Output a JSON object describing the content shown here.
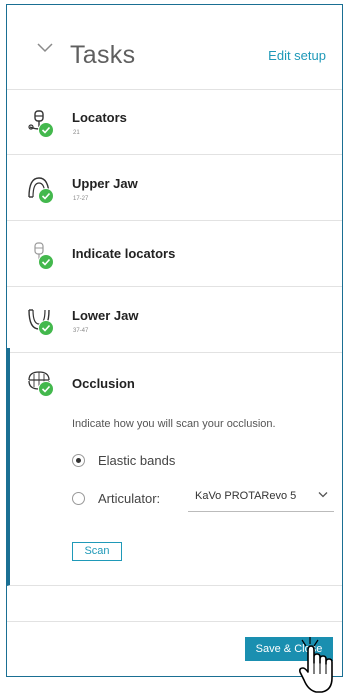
{
  "header": {
    "title": "Tasks",
    "edit_label": "Edit setup"
  },
  "tasks": [
    {
      "name": "Locators",
      "sub": "21",
      "icon": "locator-icon",
      "done": true
    },
    {
      "name": "Upper Jaw",
      "sub": "17-27",
      "icon": "upper-jaw-icon",
      "done": true
    },
    {
      "name": "Indicate locators",
      "sub": "",
      "icon": "locator-indicate-icon",
      "done": true
    },
    {
      "name": "Lower Jaw",
      "sub": "37-47",
      "icon": "lower-jaw-icon",
      "done": true
    }
  ],
  "occlusion": {
    "name": "Occlusion",
    "icon": "occlusion-icon",
    "prompt": "Indicate how you will scan your occlusion.",
    "options": [
      {
        "label": "Elastic bands",
        "selected": true
      },
      {
        "label": "Articulator:",
        "selected": false
      }
    ],
    "articulator_value": "KaVo PROTARevo 5",
    "scan_label": "Scan"
  },
  "footer": {
    "save_label": "Save & Close"
  },
  "colors": {
    "accent": "#1a8fb0",
    "border": "#1a6f93",
    "check": "#43b84d"
  }
}
